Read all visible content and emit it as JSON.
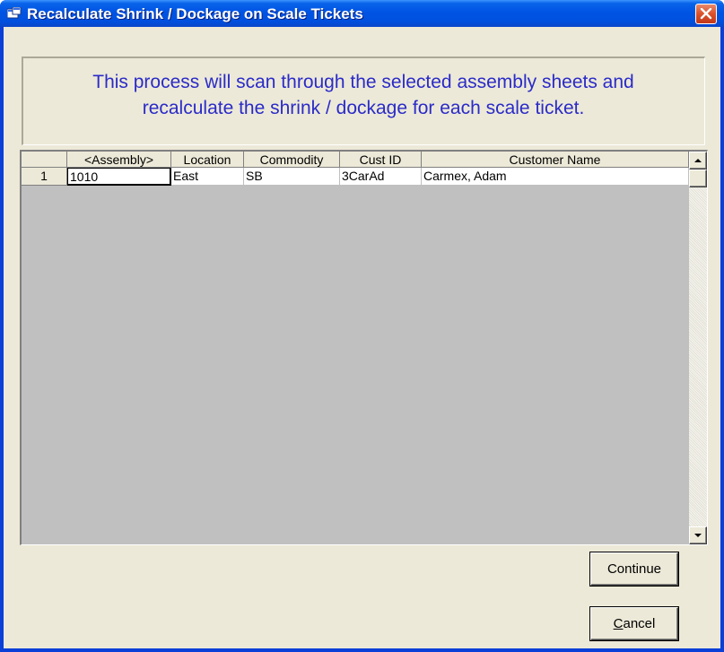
{
  "window": {
    "title": "Recalculate Shrink / Dockage on Scale Tickets"
  },
  "banner": {
    "line1": "This process will scan through the selected assembly sheets and",
    "line2": "recalculate the shrink / dockage for each scale ticket."
  },
  "grid": {
    "columns": [
      "<Assembly>",
      "Location",
      "Commodity",
      "Cust ID",
      "Customer Name"
    ],
    "rows": [
      {
        "row_number": "1",
        "assembly": "1010",
        "location": "East",
        "commodity": "SB",
        "cust_id": "3CarAd",
        "customer_name": "Carmex, Adam"
      }
    ]
  },
  "buttons": {
    "continue_label": "Continue",
    "cancel_label": "Cancel",
    "cancel_hotkey": "C",
    "cancel_rest": "ancel"
  },
  "colors": {
    "banner_text": "#2b2bc8",
    "titlebar": "#0054e3",
    "dialog_face": "#ece9d8",
    "grid_background": "#c0c0c0"
  }
}
